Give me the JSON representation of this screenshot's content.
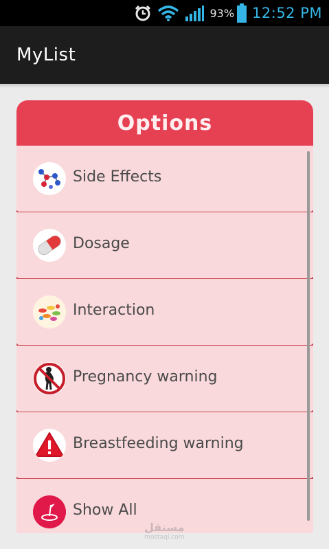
{
  "status_bar": {
    "battery_percent": "93%",
    "time": "12:52 PM",
    "icons": [
      "alarm-icon",
      "wifi-icon",
      "signal-icon",
      "battery-icon"
    ],
    "accent_color": "#35b5e5"
  },
  "action_bar": {
    "title": "MyList"
  },
  "options_card": {
    "title": "Options",
    "header_color": "#e64053",
    "body_color": "#f9d9dc",
    "items": [
      {
        "label": "Side Effects",
        "icon": "molecule-icon"
      },
      {
        "label": "Dosage",
        "icon": "pill-icon"
      },
      {
        "label": "Interaction",
        "icon": "pills-pile-icon"
      },
      {
        "label": "Pregnancy warning",
        "icon": "no-pregnancy-icon"
      },
      {
        "label": "Breastfeeding warning",
        "icon": "warning-icon"
      },
      {
        "label": "Show All",
        "icon": "show-all-icon"
      }
    ]
  },
  "watermark": {
    "text": "مستقل",
    "subtext": "mostaql.com"
  }
}
